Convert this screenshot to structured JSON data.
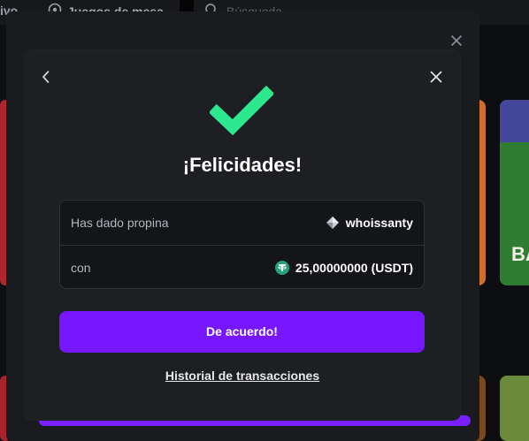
{
  "topbar": {
    "partial_label": "Vivo",
    "table_games_label": "Juegos de mesa",
    "search_placeholder": "Búsqueda"
  },
  "background": {
    "card_text": "BA"
  },
  "dialog": {
    "title": "¡Felicidades!",
    "rows": [
      {
        "label": "Has dado propina",
        "value": "whoissanty",
        "icon": "vip-diamond-icon"
      },
      {
        "label": "con",
        "value": "25,00000000 (USDT)",
        "icon": "tether-icon"
      }
    ],
    "confirm_label": "De acuerdo!",
    "history_link": "Historial de transacciones"
  },
  "colors": {
    "accent": "#7717ff",
    "success": "#2ee88f",
    "tether": "#26a17b"
  }
}
